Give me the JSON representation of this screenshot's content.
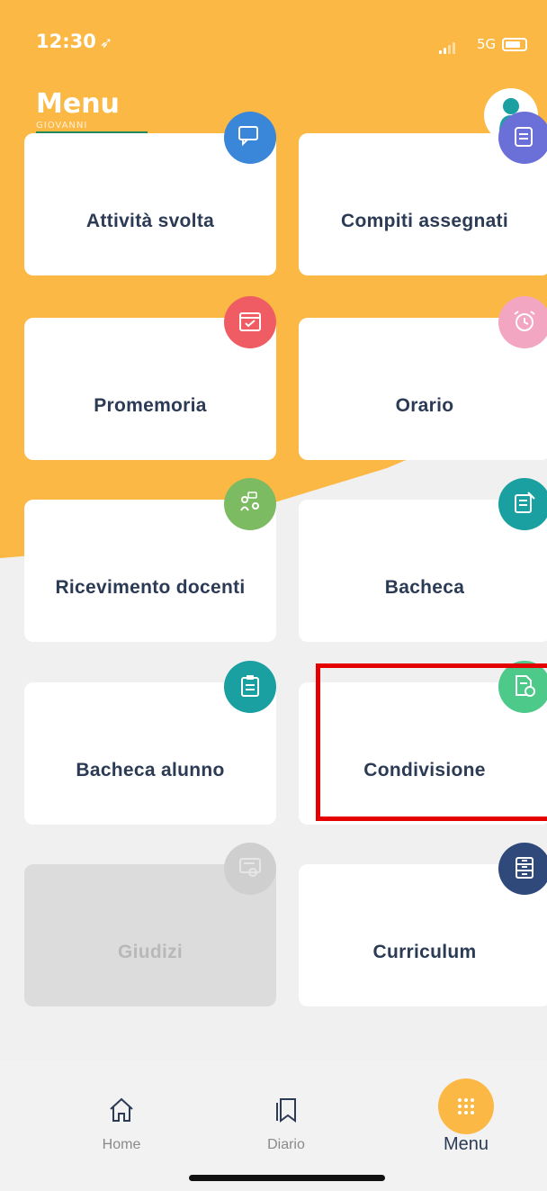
{
  "status_bar": {
    "time": "12:30",
    "network": "5G"
  },
  "header": {
    "title": "Menu",
    "username": "GIOVANNI"
  },
  "tiles": [
    {
      "label": "Attività svolta",
      "icon": "chat-icon",
      "color": "#3a86d8",
      "enabled": true
    },
    {
      "label": "Compiti assegnati",
      "icon": "homework-icon",
      "color": "#6b6fd8",
      "enabled": true
    },
    {
      "label": "Promemoria",
      "icon": "calendar-check-icon",
      "color": "#ef5c63",
      "enabled": true
    },
    {
      "label": "Orario",
      "icon": "alarm-clock-icon",
      "color": "#f3a6c2",
      "enabled": true
    },
    {
      "label": "Ricevimento docenti",
      "icon": "meeting-icon",
      "color": "#7dbb63",
      "enabled": true
    },
    {
      "label": "Bacheca",
      "icon": "notice-board-icon",
      "color": "#1aa0a0",
      "enabled": true
    },
    {
      "label": "Bacheca alunno",
      "icon": "clipboard-icon",
      "color": "#1aa0a0",
      "enabled": true
    },
    {
      "label": "Condivisione",
      "icon": "document-share-icon",
      "color": "#4dc98a",
      "enabled": true
    },
    {
      "label": "Giudizi",
      "icon": "certificate-icon",
      "color": "#cfcfcf",
      "enabled": false
    },
    {
      "label": "Curriculum",
      "icon": "cabinet-icon",
      "color": "#2f4a7a",
      "enabled": true
    }
  ],
  "bottom_nav": [
    {
      "label": "Home",
      "icon": "home-icon",
      "active": false
    },
    {
      "label": "Diario",
      "icon": "bookmark-icon",
      "active": false
    },
    {
      "label": "Menu",
      "icon": "grid-dots-icon",
      "active": true
    }
  ],
  "colors": {
    "accent": "#fbb844",
    "text": "#2b3a55",
    "highlight": "#e50000"
  }
}
